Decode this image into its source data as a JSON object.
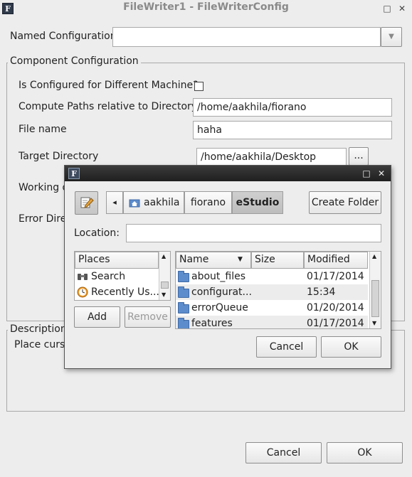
{
  "window": {
    "title": "FileWriter1 - FileWriterConfig",
    "app_icon_glyph": "F",
    "minimize_glyph": "□",
    "close_glyph": "✕"
  },
  "named_config": {
    "label": "Named Configuration",
    "value": "",
    "dropdown_glyph": "▼"
  },
  "component_config": {
    "legend": "Component Configuration",
    "different_machine_label": "Is Configured for Different Machine?",
    "different_machine_checked": false,
    "compute_paths_label": "Compute Paths relative to Directory:",
    "compute_paths_value": "/home/aakhila/fiorano",
    "file_name_label": "File name",
    "file_name_value": "haha",
    "target_dir_label": "Target Directory",
    "target_dir_value": "/home/aakhila/Desktop",
    "browse_label": "...",
    "working_label_partial": "Working d",
    "error_label_partial": "Error Dire"
  },
  "description": {
    "legend": "Description",
    "text_partial": "Place curso"
  },
  "footer": {
    "cancel_label": "Cancel",
    "ok_label": "OK"
  },
  "dialog": {
    "app_icon_glyph": "F",
    "maximize_glyph": "□",
    "close_glyph": "✕",
    "back_glyph": "◂",
    "breadcrumbs": [
      "aakhila",
      "fiorano",
      "eStudio"
    ],
    "active_crumb": "eStudio",
    "create_folder_label": "Create Folder",
    "location_label": "Location:",
    "location_value": "",
    "places_header": "Places",
    "places": [
      {
        "icon": "binoculars-icon",
        "label": "Search"
      },
      {
        "icon": "clock-icon",
        "label": "Recently Us..."
      }
    ],
    "add_label": "Add",
    "remove_label": "Remove",
    "columns": {
      "name": "Name",
      "sort_glyph": "▼",
      "size": "Size",
      "modified": "Modified"
    },
    "files": [
      {
        "name": "about_files",
        "size": "",
        "modified": "01/17/2014"
      },
      {
        "name": "configurat...",
        "size": "",
        "modified": "15:34"
      },
      {
        "name": "errorQueue",
        "size": "",
        "modified": "01/20/2014"
      },
      {
        "name": "features",
        "size": "",
        "modified": "01/17/2014"
      }
    ],
    "scroll_up_glyph": "▲",
    "scroll_down_glyph": "▼",
    "cancel_label": "Cancel",
    "ok_label": "OK"
  }
}
